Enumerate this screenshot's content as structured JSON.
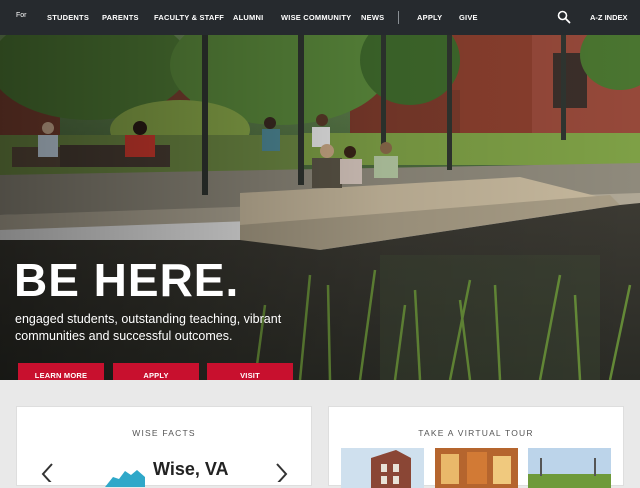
{
  "nav": {
    "for_label": "For",
    "links": [
      "STUDENTS",
      "PARENTS",
      "FACULTY & STAFF",
      "ALUMNI",
      "WISE COMMUNITY",
      "NEWS",
      "APPLY",
      "GIVE"
    ],
    "az_label": "A-Z INDEX"
  },
  "hero": {
    "headline": "BE HERE.",
    "subtext": "engaged students, outstanding teaching, vibrant communities and successful outcomes.",
    "buttons": [
      "LEARN MORE",
      "APPLY",
      "VISIT"
    ]
  },
  "facts": {
    "title": "WISE FACTS",
    "place": "Wise, VA"
  },
  "tour": {
    "title": "TAKE A VIRTUAL TOUR"
  },
  "colors": {
    "nav_bg": "#262a2e",
    "accent": "#c8102e",
    "state_map": "#2fa8c9"
  }
}
